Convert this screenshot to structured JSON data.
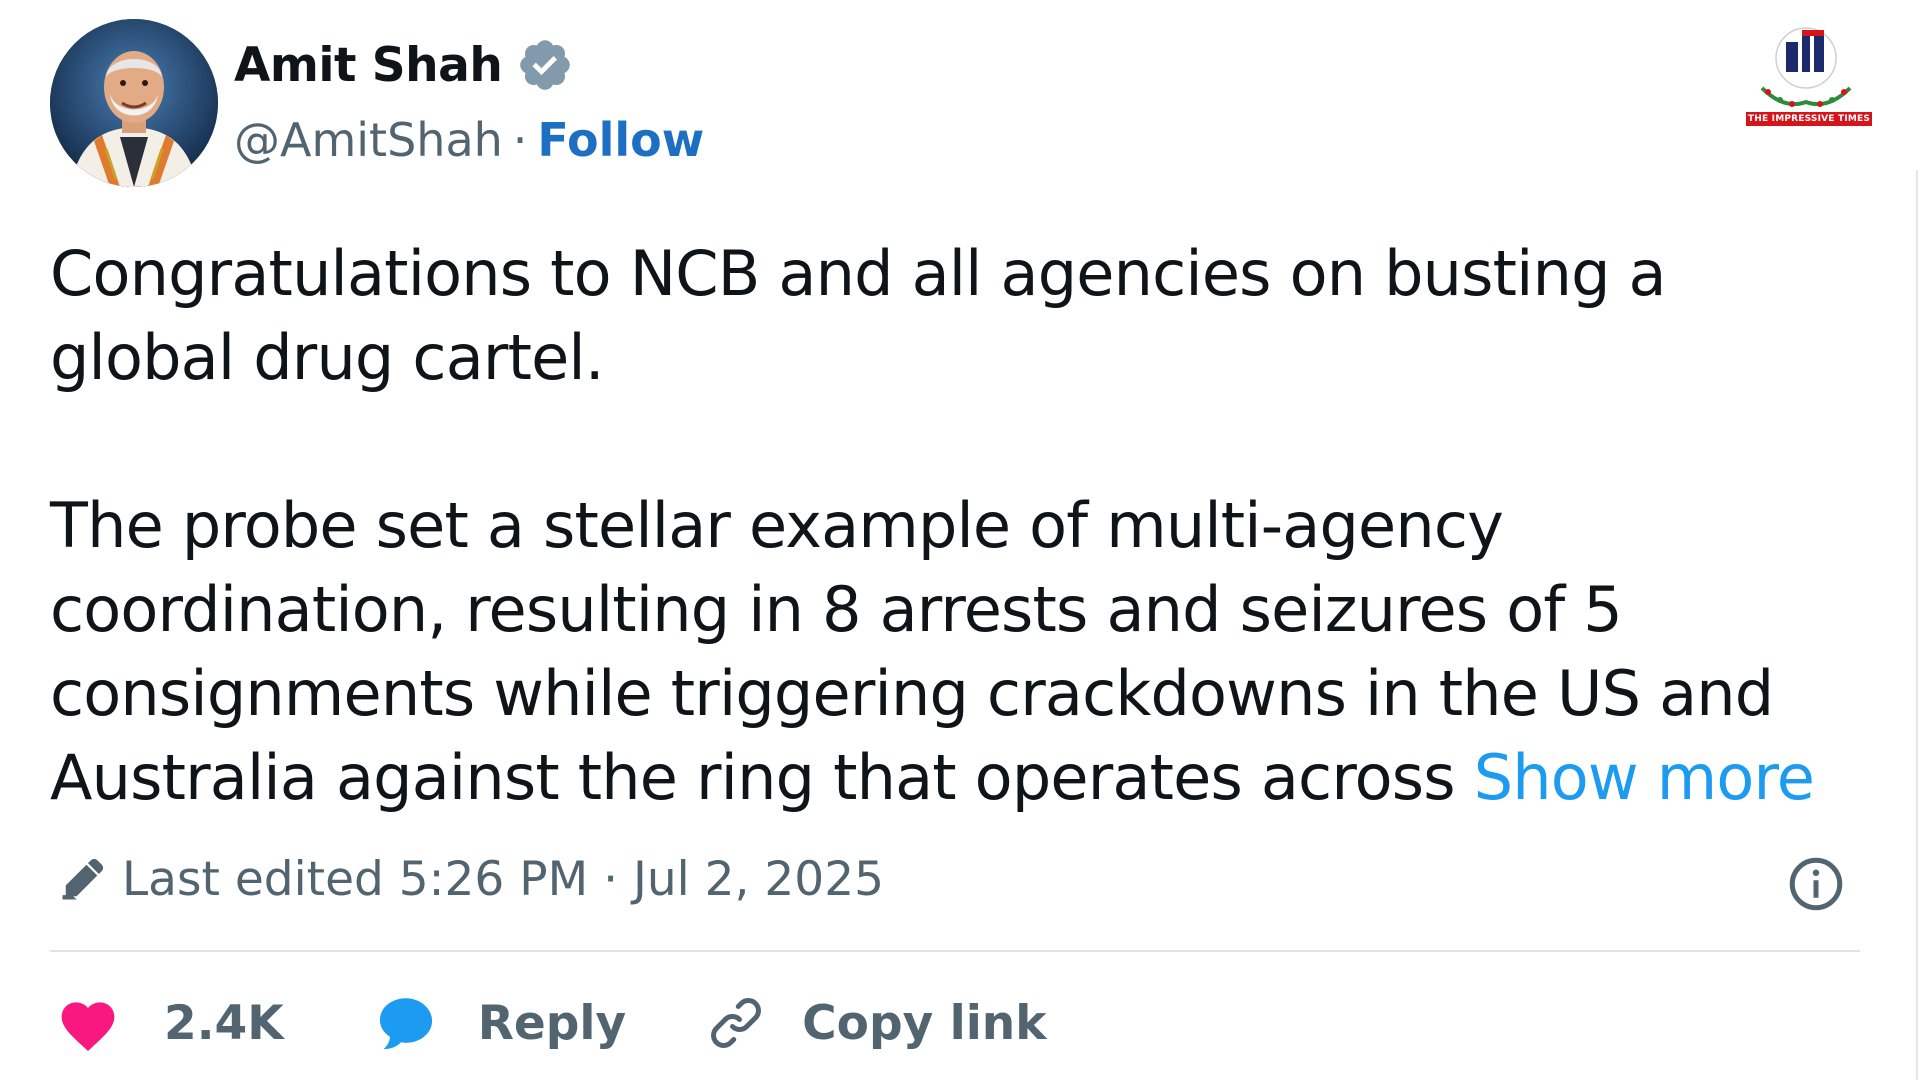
{
  "author": {
    "name": "Amit Shah",
    "handle": "@AmitShah",
    "separator": "·",
    "follow_label": "Follow",
    "verified": true
  },
  "brand": {
    "name": "THE IMPRESSIVE TIMES",
    "colors": {
      "red": "#d7141a",
      "navy": "#1a2a6c",
      "green": "#2e8b3a"
    }
  },
  "tweet": {
    "paragraph_1": "Congratulations to NCB and all agencies on busting a global drug cartel.",
    "paragraph_2_lines": [
      "The probe set a stellar example of multi-agency",
      "coordination, resulting in 8 arrests and seizures of 5",
      "consignments while triggering crackdowns in the US and",
      "Australia against the ring that operates across "
    ],
    "show_more_label": "Show more"
  },
  "edited": {
    "text": "Last edited 5:26 PM · Jul 2, 2025",
    "icon": "pencil-icon"
  },
  "actions": {
    "like_count": "2.4K",
    "reply_label": "Reply",
    "copy_link_label": "Copy link"
  },
  "colors": {
    "text": "#0f1419",
    "secondary": "#536471",
    "link": "#1d9bf0",
    "follow": "#1d6fc4",
    "like": "#f91880",
    "reply": "#1d9bf0",
    "verified_badge": "#829aab"
  }
}
